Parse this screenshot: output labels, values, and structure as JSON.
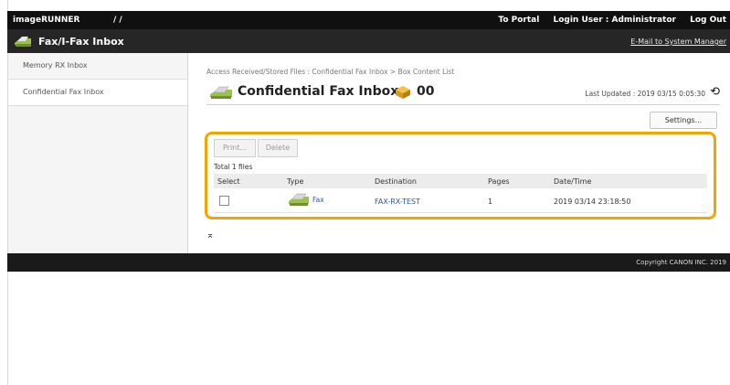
{
  "topbar": {
    "brand": "imageRUNNER",
    "brand_suffix": "/ /",
    "portal": "To Portal",
    "login_user": "Login User : Administrator",
    "logout": "Log Out"
  },
  "subbar": {
    "title": "Fax/I-Fax Inbox",
    "mail_link": "E-Mail to System Manager"
  },
  "sidebar": {
    "items": [
      {
        "label": "Memory RX Inbox"
      },
      {
        "label": "Confidential Fax Inbox"
      }
    ]
  },
  "main": {
    "breadcrumb": "Access Received/Stored Files : Confidential Fax Inbox > Box Content List",
    "heading_title": "Confidential Fax Inbox",
    "box_number": "00",
    "last_updated": "Last Updated : 2019 03/15 0:05:30",
    "settings_label": "Settings...",
    "print_label": "Print...",
    "delete_label": "Delete",
    "total": "Total 1 files",
    "columns": [
      "Select",
      "Type",
      "Destination",
      "Pages",
      "Date/Time"
    ],
    "rows": [
      {
        "type": "Fax",
        "destination": "FAX-RX-TEST",
        "pages": "1",
        "datetime": "2019 03/14 23:18:50"
      }
    ],
    "pager": "⌅"
  },
  "footer": {
    "copyright": "Copyright CANON INC. 2019"
  },
  "colors": {
    "highlight": "#f0a500",
    "link": "#2a58a8",
    "topbar": "#101010"
  },
  "icons": {
    "subbar": "fax-machine-icon",
    "heading": "fax-machine-icon",
    "box": "box-icon",
    "refresh": "refresh-icon",
    "row_type": "fax-machine-icon"
  }
}
